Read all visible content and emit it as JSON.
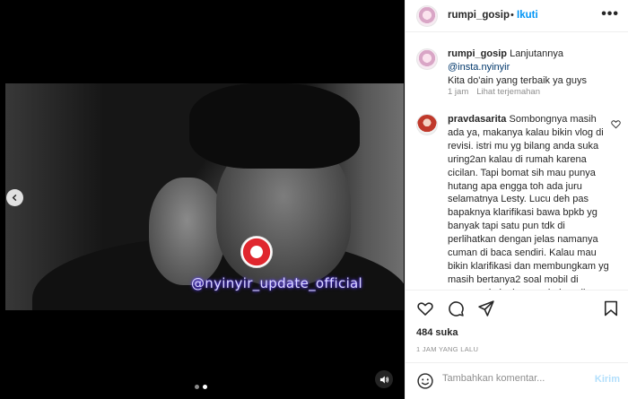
{
  "post": {
    "username": "rumpi_gosip",
    "separator": "•",
    "follow_label": "Ikuti",
    "more_label": "•••"
  },
  "media": {
    "watermark": "@nyinyir_update_official",
    "slide_count": 2,
    "active_slide": 1
  },
  "caption": {
    "username": "rumpi_gosip",
    "line1": " Lanjutannya",
    "mention": "@insta.nyinyir",
    "line3": "Kita do'ain yang terbaik ya guys",
    "time": "1 jam",
    "translate_label": "Lihat terjemahan"
  },
  "comment": {
    "username": "pravdasarita",
    "text": " Sombongnya masih ada ya, makanya kalau bikin vlog di revisi. istri mu yg bilang anda suka uring2an kalau di rumah karena cicilan. Tapi bomat sih mau punya hutang apa engga toh ada juru selamatnya Lesty. Lucu deh pas bapaknya klarifikasi bawa bpkb yg banyak tapi satu pun tdk di perlihatkan dengan jelas namanya cuman di baca sendiri. Kalau mau bikin klarifikasi dan membungkam yg masih bertanya2 soal mobil di pampangin ke kamera bukan di"
  },
  "actions": {
    "likes": "484 suka",
    "time_ago": "1 JAM YANG LALU"
  },
  "composer": {
    "placeholder": "Tambahkan komentar...",
    "post_label": "Kirim"
  },
  "colors": {
    "link_blue": "#0095f6",
    "disabled_blue": "#b2dffc",
    "meta_gray": "#8e8e8e"
  }
}
